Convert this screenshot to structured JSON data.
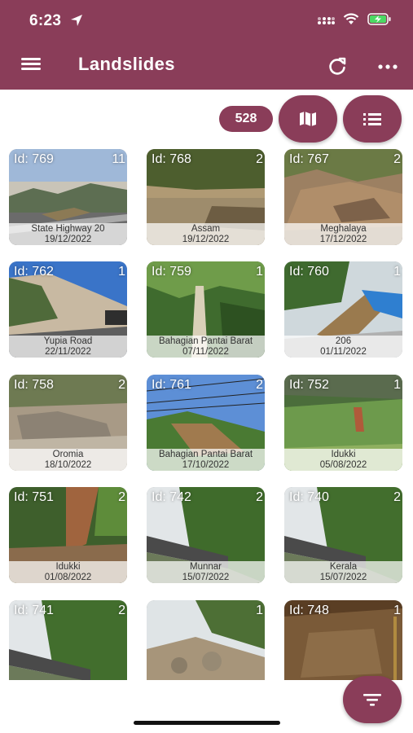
{
  "status_bar": {
    "time": "6:23",
    "icons": [
      "location-arrow-icon",
      "cellular-icon",
      "wifi-icon",
      "battery-charging-icon"
    ]
  },
  "app_bar": {
    "title": "Landslides",
    "icons": [
      "menu-icon",
      "refresh-icon",
      "more-icon"
    ]
  },
  "controls": {
    "count": "528",
    "map_icon": "map-icon",
    "list_icon": "list-icon",
    "filter_icon": "filter-icon"
  },
  "colors": {
    "primary": "#8a3d59",
    "background": "#ffffff"
  },
  "cards": [
    {
      "id": "Id: 769",
      "count": "11",
      "place": "State Highway 20",
      "date": "19/12/2022"
    },
    {
      "id": "Id: 768",
      "count": "2",
      "place": "Assam",
      "date": "19/12/2022"
    },
    {
      "id": "Id: 767",
      "count": "2",
      "place": "Meghalaya",
      "date": "17/12/2022"
    },
    {
      "id": "Id: 762",
      "count": "1",
      "place": "Yupia Road",
      "date": "22/11/2022"
    },
    {
      "id": "Id: 759",
      "count": "1",
      "place": "Bahagian Pantai Barat",
      "date": "07/11/2022"
    },
    {
      "id": "Id: 760",
      "count": "1",
      "place": "206",
      "date": "01/11/2022"
    },
    {
      "id": "Id: 758",
      "count": "2",
      "place": "Oromia",
      "date": "18/10/2022"
    },
    {
      "id": "Id: 761",
      "count": "2",
      "place": "Bahagian Pantai Barat",
      "date": "17/10/2022"
    },
    {
      "id": "Id: 752",
      "count": "1",
      "place": "Idukki",
      "date": "05/08/2022"
    },
    {
      "id": "Id: 751",
      "count": "2",
      "place": "Idukki",
      "date": "01/08/2022"
    },
    {
      "id": "Id: 742",
      "count": "2",
      "place": "Munnar",
      "date": "15/07/2022"
    },
    {
      "id": "Id: 740",
      "count": "2",
      "place": "Kerala",
      "date": "15/07/2022"
    },
    {
      "id": "Id: 741",
      "count": "2",
      "place": "",
      "date": ""
    },
    {
      "id": "",
      "count": "1",
      "place": "",
      "date": ""
    },
    {
      "id": "Id: 748",
      "count": "1",
      "place": "",
      "date": ""
    }
  ]
}
